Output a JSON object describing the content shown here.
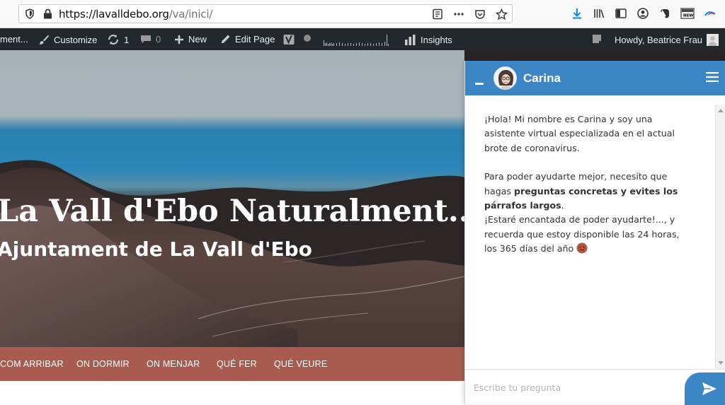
{
  "browser": {
    "url_host": "https://lavalldebo.org",
    "url_path": "/va/inici/"
  },
  "adminbar": {
    "site_label": "ment...",
    "customize": "Customize",
    "updates_count": "1",
    "comments_count": "0",
    "new_label": "New",
    "edit_page": "Edit Page",
    "insights": "Insights",
    "howdy": "Howdy, Beatrice Frau"
  },
  "hero": {
    "title": "La Vall d'Ebo Naturalment...",
    "subtitle": "Ajuntament de La Vall d'Ebo"
  },
  "nav": {
    "items": [
      "COM ARRIBAR",
      "ON DORMIR",
      "ON MENJAR",
      "QUÉ FER",
      "QUÉ VEURE"
    ]
  },
  "chat": {
    "name": "Carina",
    "msg_line1": "¡Hola! Mi nombre es Carina y soy una asistente virtual especializada en el actual brote de coronavirus.",
    "msg_p2_pre": "Para poder ayudarte mejor, necesito que hagas ",
    "msg_p2_bold": "preguntas concretas y evites los párrafos largos",
    "msg_p2_post": ".",
    "msg_p3": "¡Estaré encantada de poder ayudarte!..., y recuerda que estoy disponible las 24 horas, los 365 días del año",
    "input_placeholder": "Escribe tu pregunta"
  },
  "colors": {
    "chat_accent": "#3d86c6",
    "nav_bg": "#a95b4f",
    "adminbar_bg": "#23282d"
  }
}
